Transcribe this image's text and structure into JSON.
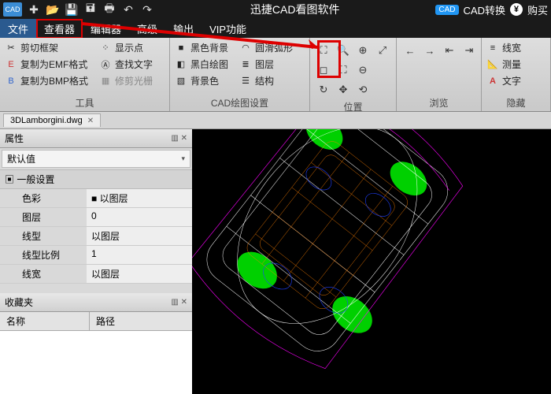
{
  "titlebar": {
    "title": "迅捷CAD看图软件",
    "cad_convert": "CAD转换",
    "buy": "购买"
  },
  "menubar": {
    "file": "文件",
    "viewer": "查看器",
    "editor": "编辑器",
    "advanced": "高级",
    "output": "输出",
    "vip": "VIP功能"
  },
  "ribbon": {
    "tools": {
      "label": "工具",
      "crop": "剪切框架",
      "emf": "复制为EMF格式",
      "bmp": "复制为BMP格式",
      "points": "显示点",
      "findtext": "查找文字",
      "grid": "修剪光栅"
    },
    "cad": {
      "label": "CAD绘图设置",
      "blackbg": "黑色背景",
      "bw": "黑白绘图",
      "bgcolor": "背景色",
      "arc": "圆滑弧形",
      "layer": "图层",
      "struct": "结构"
    },
    "pos": {
      "label": "位置"
    },
    "browse": {
      "label": "浏览"
    },
    "hide": {
      "label": "隐藏",
      "linew": "线宽",
      "measure": "测量",
      "text": "文字"
    }
  },
  "filetab": {
    "name": "3DLamborgini.dwg"
  },
  "props": {
    "title": "属性",
    "default": "默认值",
    "general": "一般设置",
    "rows": {
      "color_k": "色彩",
      "color_v": "■ 以图层",
      "layer_k": "图层",
      "layer_v": "0",
      "ltype_k": "线型",
      "ltype_v": "以图层",
      "lscale_k": "线型比例",
      "lscale_v": "1",
      "lwidth_k": "线宽",
      "lwidth_v": "以图层"
    }
  },
  "fav": {
    "title": "收藏夹",
    "name": "名称",
    "path": "路径"
  }
}
